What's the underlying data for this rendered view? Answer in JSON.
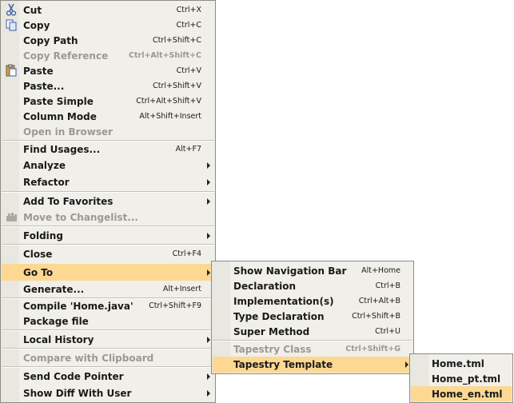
{
  "main_menu": {
    "cut": {
      "label": "Cut",
      "shortcut": "Ctrl+X",
      "icon": "scissors-icon"
    },
    "copy": {
      "label": "Copy",
      "shortcut": "Ctrl+C",
      "icon": "copy-icon"
    },
    "copy_path": {
      "label": "Copy Path",
      "shortcut": "Ctrl+Shift+C"
    },
    "copy_reference": {
      "label": "Copy Reference",
      "shortcut": "Ctrl+Alt+Shift+C"
    },
    "paste": {
      "label": "Paste",
      "shortcut": "Ctrl+V",
      "icon": "clipboard-icon"
    },
    "paste_more": {
      "label": "Paste...",
      "shortcut": "Ctrl+Shift+V"
    },
    "paste_simple": {
      "label": "Paste Simple",
      "shortcut": "Ctrl+Alt+Shift+V"
    },
    "column_mode": {
      "label": "Column Mode",
      "shortcut": "Alt+Shift+Insert"
    },
    "open_in_browser": {
      "label": "Open in Browser"
    },
    "find_usages": {
      "label": "Find Usages...",
      "shortcut": "Alt+F7"
    },
    "analyze": {
      "label": "Analyze"
    },
    "refactor": {
      "label": "Refactor"
    },
    "add_to_favorites": {
      "label": "Add To Favorites"
    },
    "move_to_changelist": {
      "label": "Move to Changelist...",
      "icon": "changelist-icon"
    },
    "folding": {
      "label": "Folding"
    },
    "close": {
      "label": "Close",
      "shortcut": "Ctrl+F4"
    },
    "go_to": {
      "label": "Go To"
    },
    "generate": {
      "label": "Generate...",
      "shortcut": "Alt+Insert"
    },
    "compile": {
      "label": "Compile 'Home.java'",
      "shortcut": "Ctrl+Shift+F9"
    },
    "package_file": {
      "label": "Package file"
    },
    "local_history": {
      "label": "Local History"
    },
    "compare_clipboard": {
      "label": "Compare with Clipboard"
    },
    "send_code_pointer": {
      "label": "Send Code Pointer"
    },
    "show_diff_user": {
      "label": "Show Diff With User"
    }
  },
  "goto_menu": {
    "nav_bar": {
      "label": "Show Navigation Bar",
      "shortcut": "Alt+Home"
    },
    "declaration": {
      "label": "Declaration",
      "shortcut": "Ctrl+B"
    },
    "implementations": {
      "label": "Implementation(s)",
      "shortcut": "Ctrl+Alt+B"
    },
    "type_declaration": {
      "label": "Type Declaration",
      "shortcut": "Ctrl+Shift+B"
    },
    "super_method": {
      "label": "Super Method",
      "shortcut": "Ctrl+U"
    },
    "tapestry_class": {
      "label": "Tapestry Class",
      "shortcut": "Ctrl+Shift+G"
    },
    "tapestry_template": {
      "label": "Tapestry Template"
    }
  },
  "template_menu": {
    "home": {
      "label": "Home.tml"
    },
    "home_pt": {
      "label": "Home_pt.tml"
    },
    "home_en": {
      "label": "Home_en.tml"
    }
  },
  "colors": {
    "highlight": "#fcd892",
    "menu_bg": "#f0efe9",
    "disabled": "#9a9a92"
  }
}
